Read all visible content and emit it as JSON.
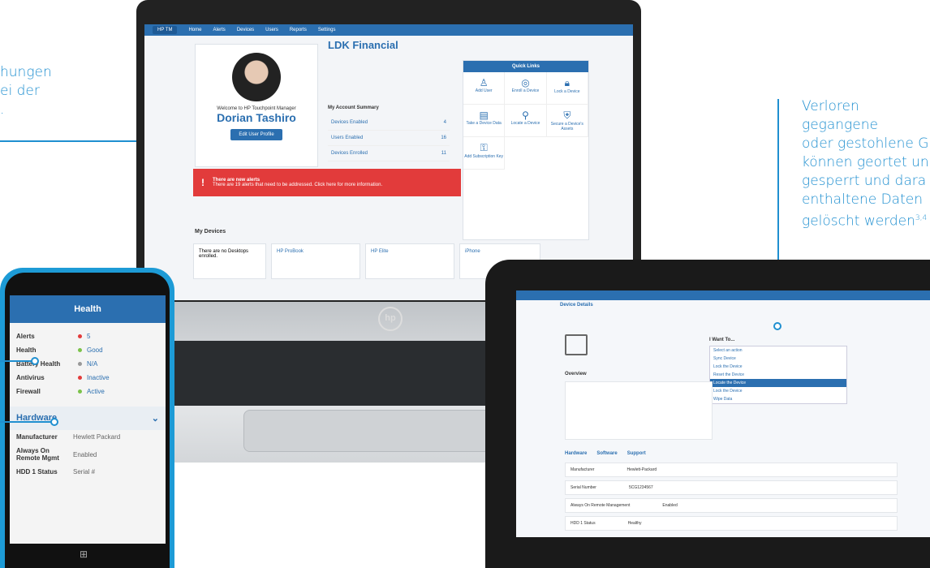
{
  "callouts": {
    "left_partial": [
      "hungen",
      "ei der",
      "."
    ],
    "right": [
      "Verloren gegangene",
      "oder gestohlene G",
      "können geortet un",
      "gesperrt und dara",
      "enthaltene Daten",
      "gelöscht werden"
    ],
    "right_sup": "3,4"
  },
  "laptop": {
    "nav_items": [
      "Home",
      "Alerts",
      "Devices",
      "Users",
      "Reports",
      "Settings"
    ],
    "company": "LDK Financial",
    "welcome": "Welcome to HP Touchpoint Manager",
    "user_name": "Dorian Tashiro",
    "edit_profile_label": "Edit User Profile",
    "summary_title": "My Account Summary",
    "summary_rows": [
      {
        "label": "Devices Enabled",
        "value": "4"
      },
      {
        "label": "Users Enabled",
        "value": "16"
      },
      {
        "label": "Devices Enrolled",
        "value": "11"
      }
    ],
    "alert_title": "There are new alerts",
    "alert_text": "There are 19 alerts that need to be addressed. Click here for more information.",
    "quick_links_title": "Quick Links",
    "quick_links": [
      {
        "label": "Add User",
        "icon": "user-icon"
      },
      {
        "label": "Enroll a Device",
        "icon": "target-icon"
      },
      {
        "label": "Lock a Device",
        "icon": "lock-icon"
      },
      {
        "label": "Take a Device Data",
        "icon": "device-icon"
      },
      {
        "label": "Locate a Device",
        "icon": "pin-icon"
      },
      {
        "label": "Secure a Device's Assets",
        "icon": "shield-icon"
      },
      {
        "label": "Add Subscription Key",
        "icon": "key-icon"
      }
    ],
    "my_devices_title": "My Devices",
    "devices": [
      {
        "label": "There are no Desktops enrolled."
      },
      {
        "label": "HP ProBook"
      },
      {
        "label": "HP Elite"
      },
      {
        "label": "iPhone"
      }
    ]
  },
  "phone": {
    "header": "Health",
    "rows": [
      {
        "key": "Alerts",
        "value": "5",
        "status_color": "#e23b3b"
      },
      {
        "key": "Health",
        "value": "Good",
        "status_color": "#7cc24a"
      },
      {
        "key": "Battery Health",
        "value": "N/A",
        "status_color": "#999999"
      },
      {
        "key": "Antivirus",
        "value": "Inactive",
        "status_color": "#e23b3b"
      },
      {
        "key": "Firewall",
        "value": "Active",
        "status_color": "#7cc24a"
      }
    ],
    "hardware_title": "Hardware",
    "hardware_rows": [
      {
        "key": "Manufacturer",
        "value": "Hewlett Packard"
      },
      {
        "key": "Always On Remote Mgmt",
        "value": "Enabled"
      },
      {
        "key": "HDD 1 Status",
        "value": "Serial #"
      }
    ]
  },
  "tablet": {
    "subtitle": "Device Details",
    "menu_title": "I Want To...",
    "menu_items": [
      "Select an action",
      "Sync Device",
      "Lock the Device",
      "Reset the Device",
      "Locate the Device",
      "Lock the Device",
      "Wipe Data"
    ],
    "selected_index": 4,
    "overview_title": "Overview",
    "tabs": [
      "Hardware",
      "Software",
      "Support"
    ],
    "rows": [
      {
        "key": "Manufacturer",
        "value": "Hewlett-Packard"
      },
      {
        "key": "Serial Number",
        "value": "5CG1234567"
      },
      {
        "key": "Always On Remote Management",
        "value": "Enabled"
      },
      {
        "key": "HDD 1 Status",
        "value": "Healthy"
      }
    ]
  },
  "colors": {
    "accent": "#1f8fd0",
    "brand": "#2b6fb0",
    "alert": "#e23b3b",
    "good": "#7cc24a"
  }
}
